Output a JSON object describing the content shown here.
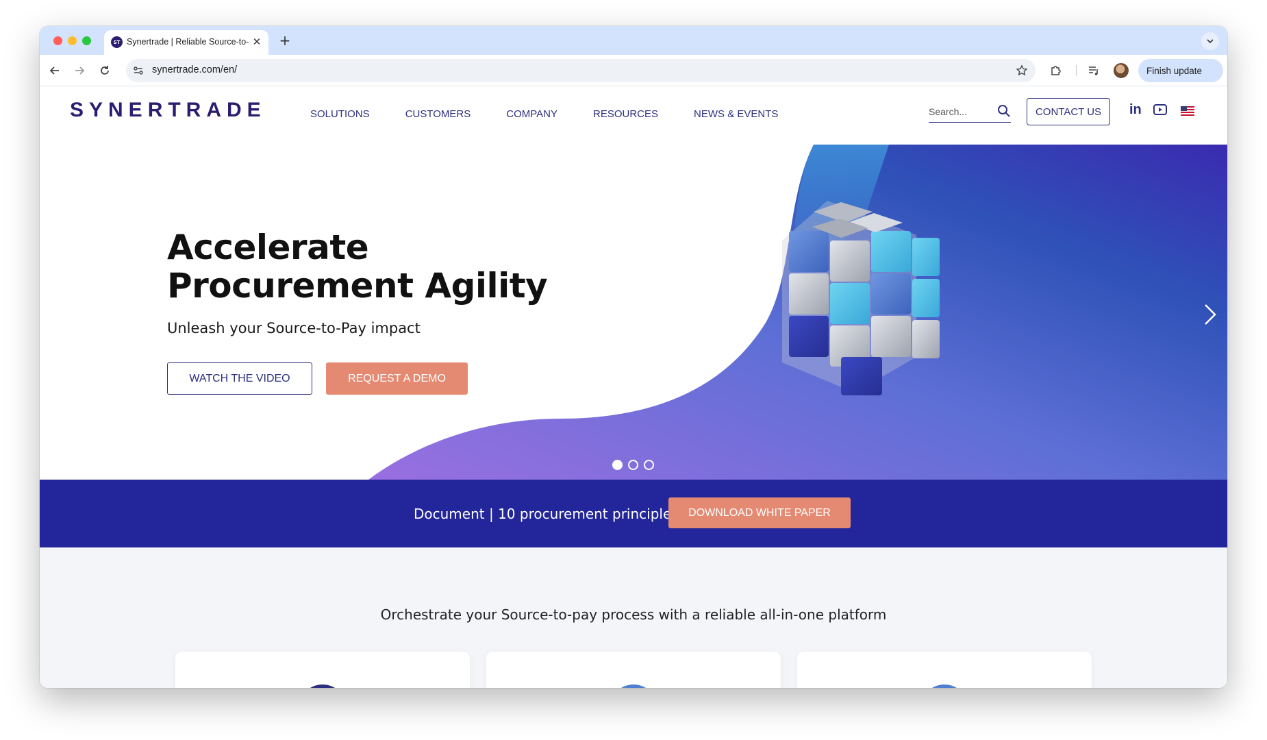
{
  "browser": {
    "tab_title": "Synertrade | Reliable Source-to-Pay",
    "tab_favicon_text": "ST",
    "url": "synertrade.com/en/",
    "finish_update_label": "Finish update"
  },
  "header": {
    "logo": "SYNERTRADE",
    "nav": [
      "SOLUTIONS",
      "CUSTOMERS",
      "COMPANY",
      "RESOURCES",
      "NEWS & EVENTS"
    ],
    "search_placeholder": "Search...",
    "contact_label": "CONTACT US",
    "linkedin_label": "in"
  },
  "hero": {
    "title_line1": "Accelerate",
    "title_line2": "Procurement Agility",
    "subtitle": "Unleash your Source-to-Pay impact",
    "watch_video_label": "WATCH THE VIDEO",
    "request_demo_label": "REQUEST A DEMO",
    "slides_total": 3,
    "active_slide": 1
  },
  "banner": {
    "text": "Document | 10 procurement principles",
    "button_label": "DOWNLOAD WHITE PAPER"
  },
  "platform": {
    "heading": "Orchestrate your Source-to-pay process with a reliable all-in-one platform"
  },
  "colors": {
    "brand_navy": "#2b2f7d",
    "banner_blue": "#23259a",
    "accent_coral": "#e48a72"
  }
}
